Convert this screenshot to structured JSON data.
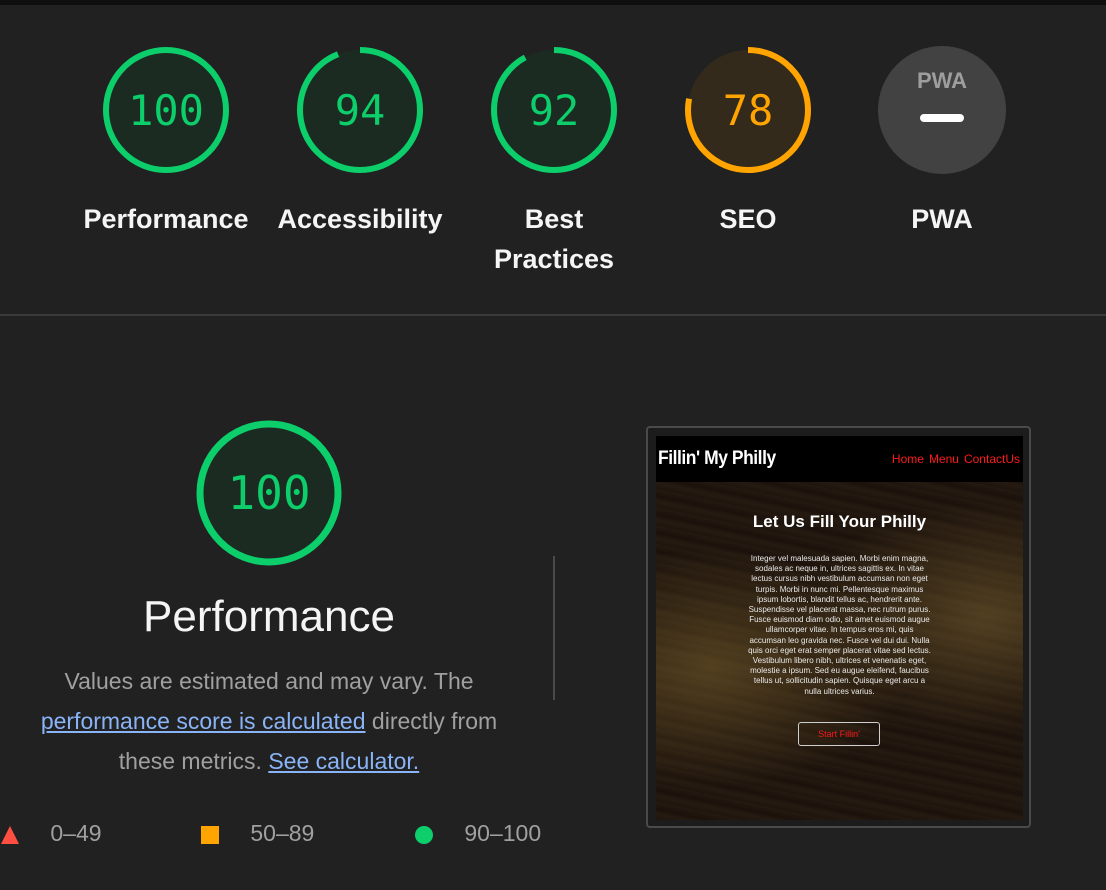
{
  "gauges": [
    {
      "score": "100",
      "value": 100,
      "label": "Performance",
      "color": "#0cce6b",
      "fill": "#1c2b22"
    },
    {
      "score": "94",
      "value": 94,
      "label": "Accessibility",
      "color": "#0cce6b",
      "fill": "#1c2b22"
    },
    {
      "score": "92",
      "value": 92,
      "label": "Best Practices",
      "color": "#0cce6b",
      "fill": "#1c2b22"
    },
    {
      "score": "78",
      "value": 78,
      "label": "SEO",
      "color": "#ffa400",
      "fill": "#332a1c"
    },
    {
      "label": "PWA",
      "badge": "PWA",
      "icon": "pwa-icon"
    }
  ],
  "performance": {
    "score": "100",
    "value": 100,
    "title": "Performance",
    "desc_text_1": "Values are estimated and may vary. The ",
    "desc_link_1": "performance score is calculated",
    "desc_text_2": " directly from these metrics. ",
    "desc_link_2": "See calculator."
  },
  "legend": [
    {
      "range": "0–49",
      "icon": "triangle-icon",
      "color": "#ff4e42"
    },
    {
      "range": "50–89",
      "icon": "square-icon",
      "color": "#ffa400"
    },
    {
      "range": "90–100",
      "icon": "circle-icon",
      "color": "#0cce6b"
    }
  ],
  "screenshot": {
    "brand": "Fillin' My Philly",
    "nav": [
      "Home",
      "Menu",
      "ContactUs"
    ],
    "hero_title": "Let Us Fill Your Philly",
    "hero_body": "Integer vel malesuada sapien. Morbi enim magna, sodales ac neque in, ultrices sagittis ex. In vitae lectus cursus nibh vestibulum accumsan non eget turpis. Morbi in nunc mi. Pellentesque maximus ipsum lobortis, blandit tellus ac, hendrerit ante. Suspendisse vel placerat massa, nec rutrum purus. Fusce euismod diam odio, sit amet euismod augue ullamcorper vitae. In tempus eros mi, quis accumsan leo gravida nec. Fusce vel dui dui. Nulla quis orci eget erat semper placerat vitae sed lectus. Vestibulum libero nibh, ultrices et venenatis eget, molestie a ipsum. Sed eu augue eleifend, faucibus tellus ut, sollicitudin sapien. Quisque eget arcu a nulla ultrices varius.",
    "button": "Start Fillin'"
  }
}
